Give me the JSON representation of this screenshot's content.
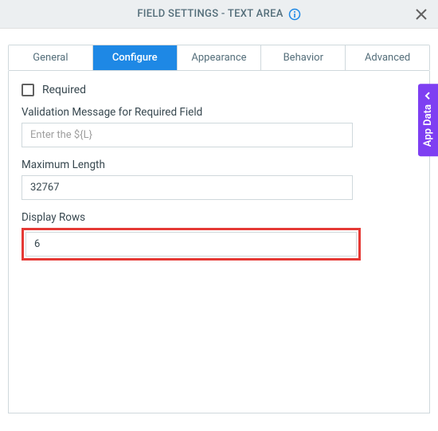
{
  "header": {
    "title": "FIELD SETTINGS - TEXT AREA"
  },
  "tabs": {
    "items": [
      {
        "label": "General"
      },
      {
        "label": "Configure"
      },
      {
        "label": "Appearance"
      },
      {
        "label": "Behavior"
      },
      {
        "label": "Advanced"
      }
    ],
    "activeIndex": 1
  },
  "configure": {
    "required": {
      "label": "Required",
      "checked": false
    },
    "validationMessage": {
      "label": "Validation Message for Required Field",
      "placeholder": "Enter the ${L}",
      "value": ""
    },
    "maximumLength": {
      "label": "Maximum Length",
      "value": "32767"
    },
    "displayRows": {
      "label": "Display Rows",
      "value": "6"
    }
  },
  "sideTab": {
    "label": "App Data"
  }
}
